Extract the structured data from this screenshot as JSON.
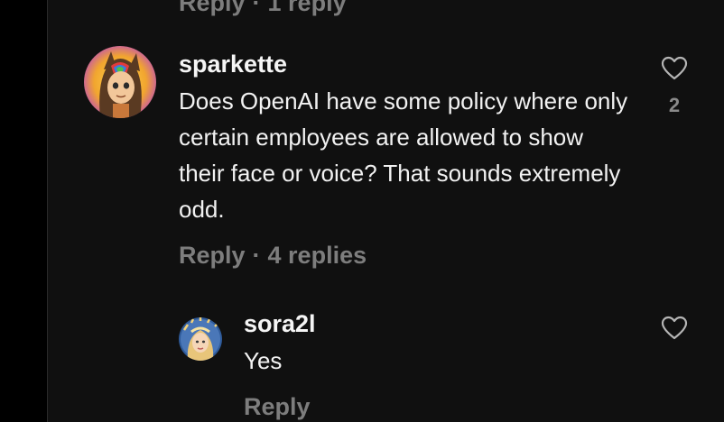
{
  "colors": {
    "background": "#101010",
    "rail": "#000000",
    "muted": "#7d7d7d",
    "text": "#f2f2f2"
  },
  "previous_comment": {
    "reply_label": "Reply",
    "separator": "·",
    "replies_label": "1 reply"
  },
  "comment": {
    "username": "sparkette",
    "text": "Does OpenAI have some policy where only certain employees are allowed to show their face or voice? That sounds extremely odd.",
    "like_icon": "heart-outline-icon",
    "like_count": "2",
    "reply_label": "Reply",
    "separator": "·",
    "replies_label": "4 replies"
  },
  "reply": {
    "username": "sora2l",
    "text": "Yes",
    "like_icon": "heart-outline-icon",
    "reply_label": "Reply"
  }
}
